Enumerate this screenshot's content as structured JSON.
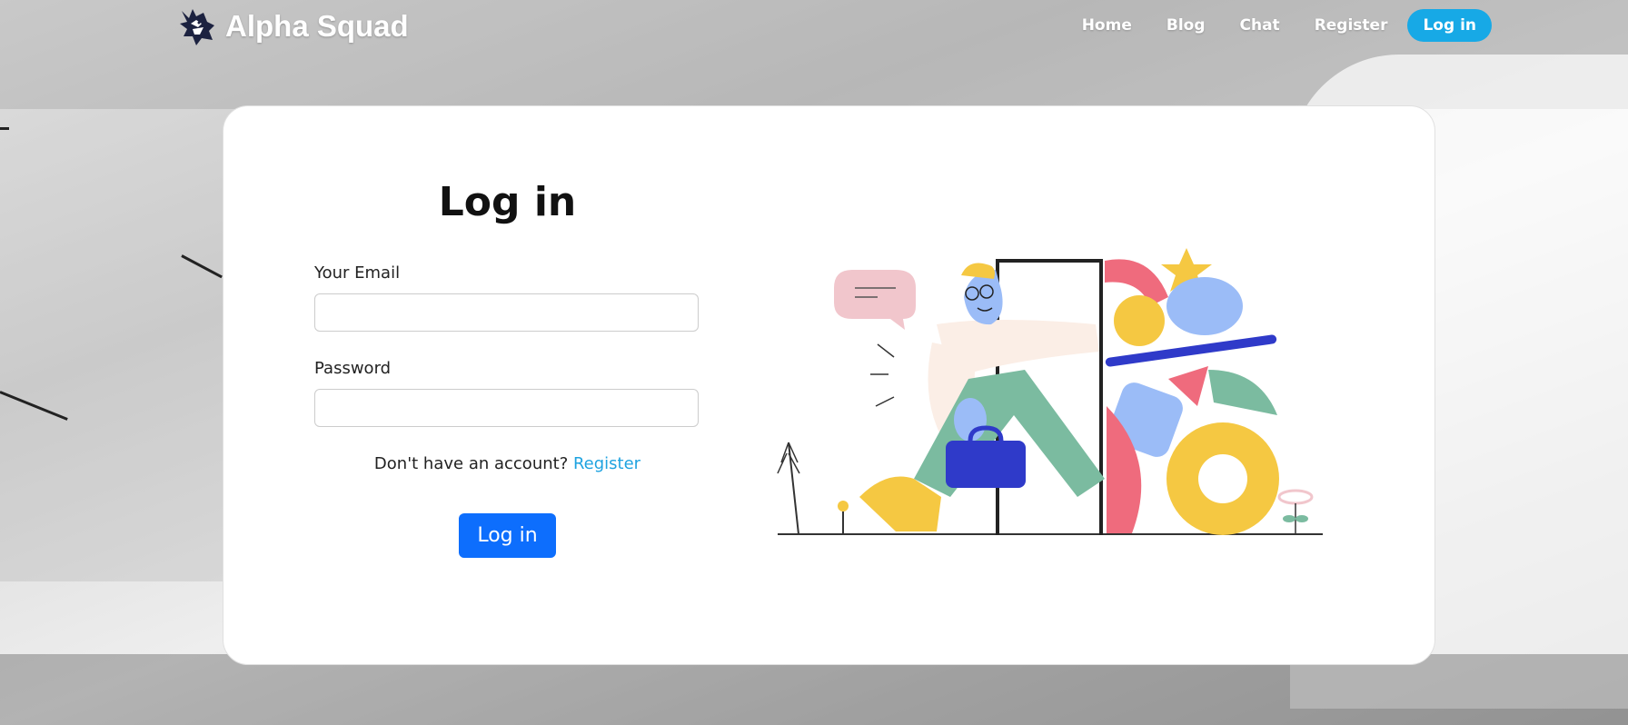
{
  "header": {
    "brand_name": "Alpha Squad",
    "nav": [
      {
        "label": "Home"
      },
      {
        "label": "Blog"
      },
      {
        "label": "Chat"
      },
      {
        "label": "Register"
      }
    ],
    "login_button": "Log in"
  },
  "form": {
    "title": "Log in",
    "email_label": "Your Email",
    "email_value": "",
    "password_label": "Password",
    "password_value": "",
    "prompt_text": "Don't have an account? ",
    "register_link": "Register",
    "submit_label": "Log in"
  },
  "colors": {
    "accent_blue": "#0d6efd",
    "nav_login": "#17a9e6",
    "link": "#1fa3e0"
  },
  "icons": {
    "logo": "wolf-logo-icon",
    "illustration": "person-through-door-illustration"
  }
}
